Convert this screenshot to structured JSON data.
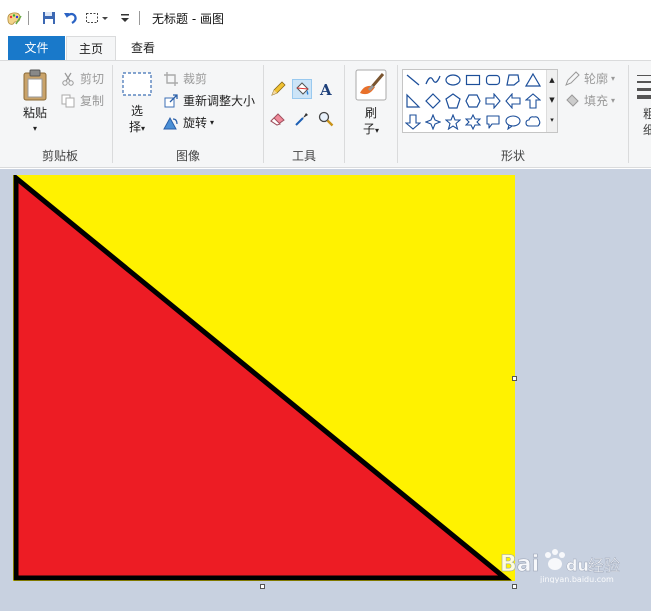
{
  "window": {
    "title": "无标题 - 画图"
  },
  "tabs": {
    "file": "文件",
    "home": "主页",
    "view": "查看"
  },
  "clipboard": {
    "label": "剪贴板",
    "paste": "粘贴",
    "cut": "剪切",
    "copy": "复制"
  },
  "image": {
    "label": "图像",
    "select_line1": "选",
    "select_line2": "择",
    "crop": "裁剪",
    "resize": "重新调整大小",
    "rotate": "旋转"
  },
  "tools": {
    "label": "工具"
  },
  "brushes": {
    "line1": "刷",
    "line2": "子"
  },
  "shapes": {
    "label": "形状",
    "outline": "轮廓",
    "fill": "填充"
  },
  "partial": {
    "size_line1": "粗",
    "size_line2": "细"
  },
  "canvas": {
    "background_color": "#fff200",
    "triangle_color": "#ed1c24",
    "stroke_color": "#000000"
  },
  "watermark": {
    "brand": "Bai",
    "brand2": "du",
    "suffix": "经验",
    "url": "jingyan.baidu.com"
  }
}
